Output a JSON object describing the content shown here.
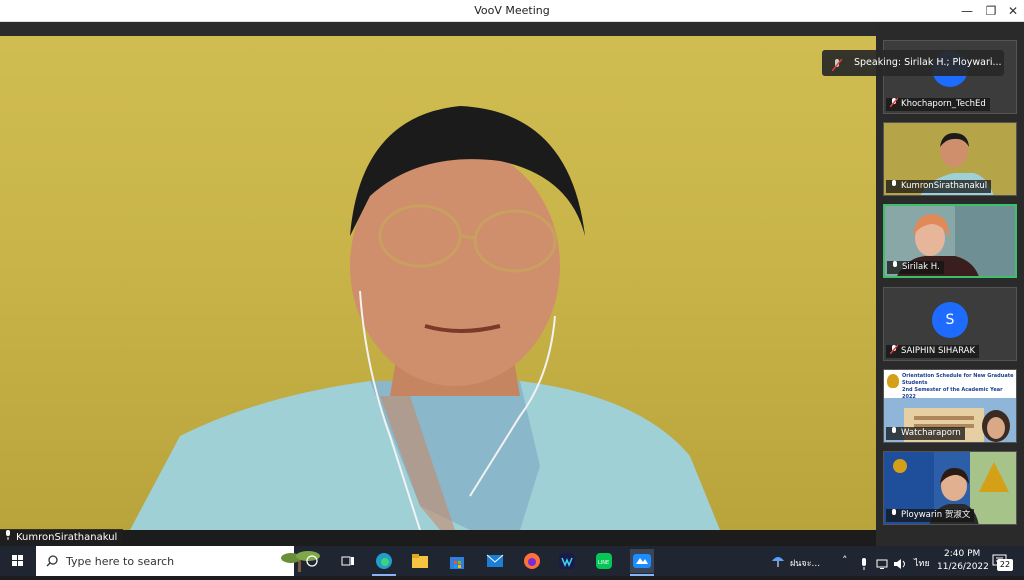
{
  "window": {
    "title": "VooV Meeting"
  },
  "main_video": {
    "participant": "KumronSirathanakul"
  },
  "speaking_banner": {
    "text": "Speaking: Sirilak H.; Ploywari..."
  },
  "participants": [
    {
      "name": "Khochaporn_TechEd",
      "mic": "muted",
      "avatar_letter": ""
    },
    {
      "name": "KumronSirathanakul",
      "mic": "on"
    },
    {
      "name": "Sirilak H.",
      "mic": "on",
      "active": true
    },
    {
      "name": "SAIPHIN SIHARAK",
      "mic": "muted",
      "avatar_letter": "S"
    },
    {
      "name": "Watcharaporn",
      "mic": "on",
      "shared_slide": {
        "line1": "Orientation Schedule for New Graduate Students",
        "line2": "2nd Semester of the Academic Year 2022"
      }
    },
    {
      "name": "Ploywarin 贺淑文",
      "mic": "on"
    }
  ],
  "taskbar": {
    "search_placeholder": "Type here to search",
    "weather": "ฝนจะ...",
    "lang": "ไทย",
    "time": "2:40 PM",
    "date": "11/26/2022",
    "notifications": "22"
  },
  "colors": {
    "accent_blue": "#1d6cff",
    "active_border": "#3fbf6a",
    "wall": "#c9b54a"
  }
}
